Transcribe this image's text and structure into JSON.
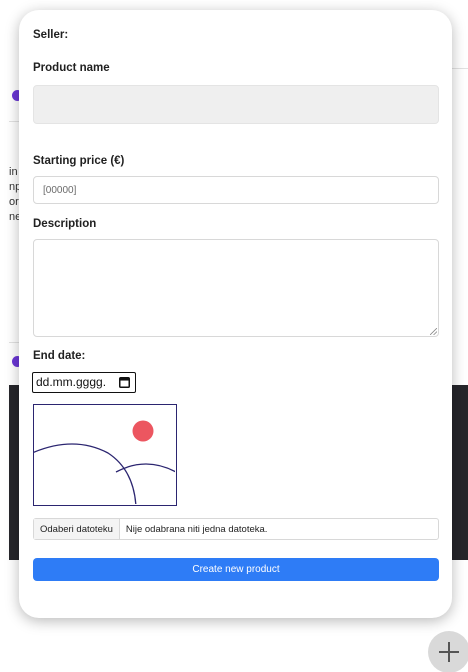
{
  "background": {
    "text_fragments": [
      "in",
      "np",
      "or",
      "ne"
    ]
  },
  "modal": {
    "seller_label": "Seller:",
    "product_name_label": "Product name",
    "product_name_value": "",
    "starting_price_label": "Starting price (€)",
    "starting_price_placeholder": "[00000]",
    "description_label": "Description",
    "description_value": "",
    "end_date_label": "End date:",
    "end_date_placeholder": "dd.mm.gggg.",
    "file_button_label": "Odaberi datoteku",
    "file_status": "Nije odabrana niti jedna datoteka.",
    "submit_label": "Create new product"
  },
  "colors": {
    "accent_button": "#2e7cf6",
    "preview_stroke": "#2b2570",
    "preview_dot": "#ec5660",
    "background_dots": "#6a36d6",
    "background_dark_panel": "#26262b"
  },
  "icons": [
    "calendar-icon",
    "plus-icon",
    "image-placeholder-icon",
    "resize-grip-icon"
  ]
}
